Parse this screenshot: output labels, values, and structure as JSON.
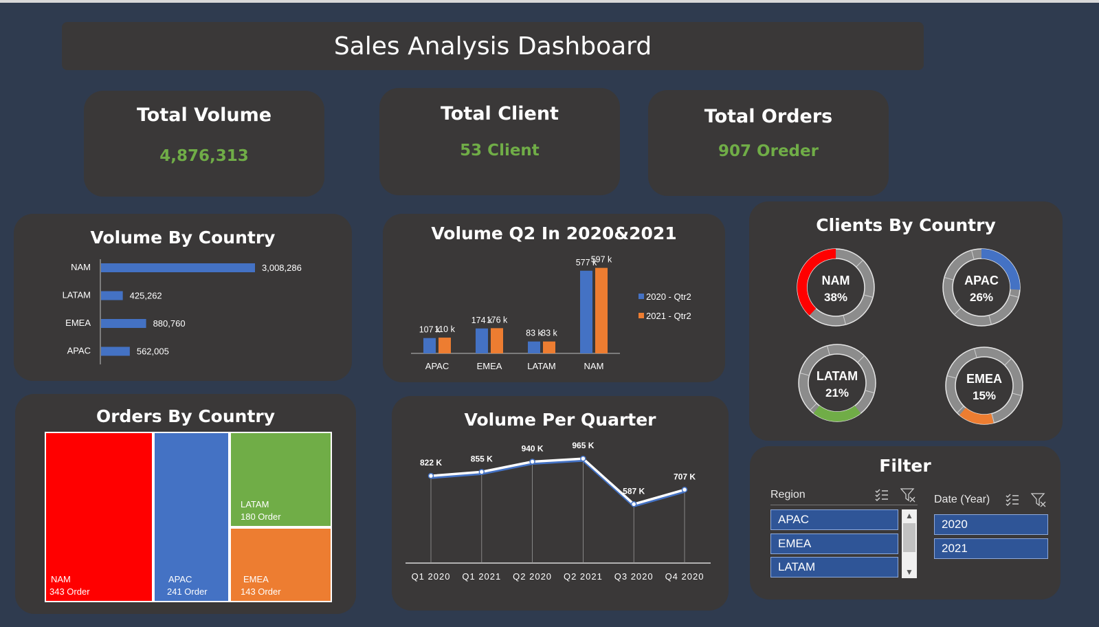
{
  "dashboard": {
    "title": "Sales Analysis Dashboard"
  },
  "kpis": {
    "volume": {
      "title": "Total Volume",
      "value": "4,876,313"
    },
    "client": {
      "title": "Total Client",
      "value": "53 Client"
    },
    "orders": {
      "title": "Total Orders",
      "value": "907 Oreder"
    }
  },
  "colors": {
    "blue": "#4472c4",
    "orange": "#ed7d31",
    "green": "#70ad47",
    "red": "#ff0000",
    "kpi_green": "#70ad47"
  },
  "volume_by_country": {
    "title": "Volume By Country",
    "chart_data": {
      "type": "bar",
      "orientation": "horizontal",
      "categories": [
        "NAM",
        "LATAM",
        "EMEA",
        "APAC"
      ],
      "values": [
        3008286,
        425262,
        880760,
        562005
      ],
      "data_labels": [
        "3,008,286",
        "425,262",
        "880,760",
        "562,005"
      ],
      "xlim": [
        0,
        3008286
      ]
    }
  },
  "volume_q2": {
    "title": "Volume Q2 In 2020&2021",
    "chart_data": {
      "type": "bar",
      "categories": [
        "APAC",
        "EMEA",
        "LATAM",
        "NAM"
      ],
      "series": [
        {
          "name": "2020 - Qtr2",
          "values": [
            107,
            174,
            83,
            577
          ],
          "labels": [
            "107 k",
            "174 k",
            "83 k",
            "577 k"
          ]
        },
        {
          "name": "2021 - Qtr2",
          "values": [
            110,
            176,
            83,
            597
          ],
          "labels": [
            "110 k",
            "176 k",
            "83 k",
            "597 k"
          ]
        }
      ],
      "legend": "right",
      "ylim": [
        0,
        600
      ]
    }
  },
  "clients_by_country": {
    "title": "Clients By Country",
    "chart_data": {
      "type": "pie",
      "variant": "donut",
      "slices": [
        {
          "label": "NAM",
          "value": 38,
          "text": "38%"
        },
        {
          "label": "APAC",
          "value": 26,
          "text": "26%"
        },
        {
          "label": "LATAM",
          "value": 21,
          "text": "21%"
        },
        {
          "label": "EMEA",
          "value": 15,
          "text": "15%"
        }
      ]
    }
  },
  "orders_by_country": {
    "title": "Orders By Country",
    "chart_data": {
      "type": "treemap",
      "items": [
        {
          "label": "NAM",
          "value": 343,
          "text": "343 Order"
        },
        {
          "label": "APAC",
          "value": 241,
          "text": "241 Order"
        },
        {
          "label": "LATAM",
          "value": 180,
          "text": "180 Order"
        },
        {
          "label": "EMEA",
          "value": 143,
          "text": "143 Order"
        }
      ]
    }
  },
  "volume_per_quarter": {
    "title": "Volume Per Quarter",
    "chart_data": {
      "type": "line",
      "categories": [
        "Q1 2020",
        "Q1 2021",
        "Q2 2020",
        "Q2 2021",
        "Q3 2020",
        "Q4 2020"
      ],
      "values": [
        822,
        855,
        940,
        965,
        587,
        707
      ],
      "data_labels": [
        "822 K",
        "855 K",
        "940 K",
        "965 K",
        "587 K",
        "707 K"
      ],
      "ylim": [
        0,
        1000
      ]
    }
  },
  "filter": {
    "title": "Filter",
    "region": {
      "label": "Region",
      "items": [
        "APAC",
        "EMEA",
        "LATAM"
      ]
    },
    "year": {
      "label": "Date (Year)",
      "items": [
        "2020",
        "2021"
      ]
    }
  }
}
